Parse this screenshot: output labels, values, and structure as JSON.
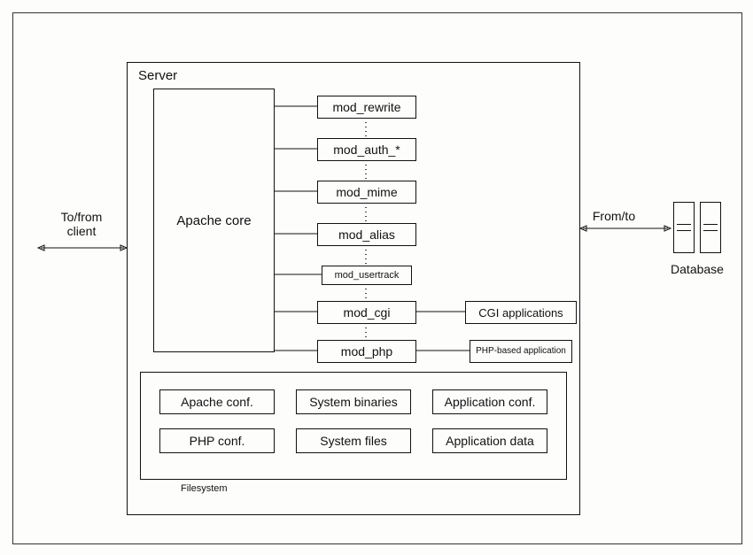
{
  "labels": {
    "server": "Server",
    "apache_core": "Apache core",
    "client": "To/from client",
    "db_fromto": "From/to",
    "database": "Database",
    "filesystem": "Filesystem"
  },
  "modules": {
    "mod_rewrite": "mod_rewrite",
    "mod_auth": "mod_auth_*",
    "mod_mime": "mod_mime",
    "mod_alias": "mod_alias",
    "mod_usertrack": "mod_usertrack",
    "mod_cgi": "mod_cgi",
    "mod_php": "mod_php"
  },
  "side": {
    "cgi_apps": "CGI applications",
    "php_app": "PHP-based application"
  },
  "fs": {
    "apache_conf": "Apache conf.",
    "system_binaries": "System binaries",
    "application_conf": "Application conf.",
    "php_conf": "PHP conf.",
    "system_files": "System files",
    "application_data": "Application data"
  }
}
